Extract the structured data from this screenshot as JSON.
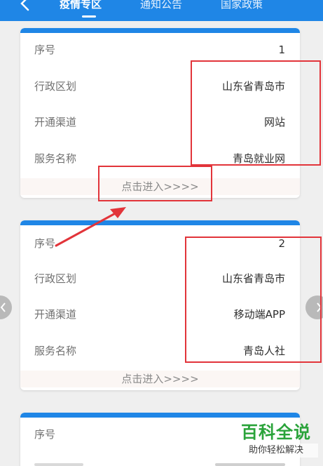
{
  "header": {
    "tabs": [
      {
        "label": "疫情专区",
        "active": true
      },
      {
        "label": "通知公告",
        "active": false
      },
      {
        "label": "国家政策",
        "active": false
      }
    ]
  },
  "cards": [
    {
      "rows": [
        {
          "label": "序号",
          "value": "1"
        },
        {
          "label": "行政区划",
          "value": "山东省青岛市"
        },
        {
          "label": "开通渠道",
          "value": "网站"
        },
        {
          "label": "服务名称",
          "value": "青岛就业网"
        }
      ],
      "enter": "点击进入>>>>"
    },
    {
      "rows": [
        {
          "label": "序号",
          "value": "2"
        },
        {
          "label": "行政区划",
          "value": "山东省青岛市"
        },
        {
          "label": "开通渠道",
          "value": "移动端APP"
        },
        {
          "label": "服务名称",
          "value": "青岛人社"
        }
      ],
      "enter": "点击进入>>>>"
    },
    {
      "rows": [
        {
          "label": "序号",
          "value": ""
        }
      ]
    }
  ],
  "colors": {
    "primary": "#1f86e6",
    "annotation": "#e2343a",
    "watermark": "#2aa33a"
  },
  "icons": [
    "back-arrow-icon",
    "chevron-left-icon",
    "chevron-right-icon"
  ],
  "watermark": {
    "title": "百科全说",
    "subtitle": "助你轻松解决"
  }
}
